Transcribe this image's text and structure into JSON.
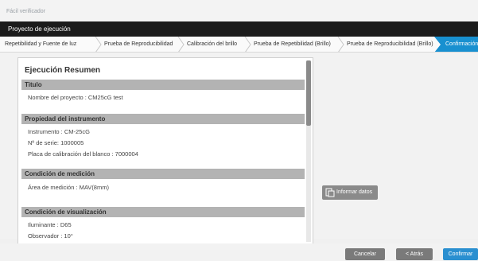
{
  "window": {
    "app_name": "Fácil verificador"
  },
  "header": {
    "title": "Proyecto de ejecución"
  },
  "breadcrumb": {
    "steps": [
      "Repetibilidad y Fuente de luz",
      "Prueba de Reproducibilidad",
      "Calibración del brillo",
      "Prueba de Repetibilidad (Brillo)",
      "Prueba de Reproducibilidad (Brillo)",
      "Confirmación"
    ],
    "active_index": 5
  },
  "summary": {
    "title": "Ejecución Resumen",
    "sections": [
      {
        "header": "Titulo",
        "lines": [
          "Nombre del proyecto : CM25cG test"
        ]
      },
      {
        "header": "Propiedad del instrumento",
        "lines": [
          "Instrumento : CM-25cG",
          "Nº de serie: 1000005",
          "Placa de calibración del blanco : 7000004"
        ]
      },
      {
        "header": "Condición de medición",
        "lines": [
          "Área de medición : MAV(8mm)"
        ]
      },
      {
        "header": "Condición de visualización",
        "lines": [
          "Iluminante : D65",
          "Observador : 10°"
        ]
      }
    ],
    "scroll_fraction": 0.36
  },
  "actions": {
    "report_label": "Informar datos"
  },
  "footer": {
    "cancel_label": "Cancelar",
    "back_label": "< Atrás",
    "confirm_label": "Confirmar"
  },
  "colors": {
    "accent": "#1890d0",
    "header_bg": "#1b1b1b",
    "section_bg": "#b3b3b3",
    "button_gray": "#7a7a7a"
  }
}
